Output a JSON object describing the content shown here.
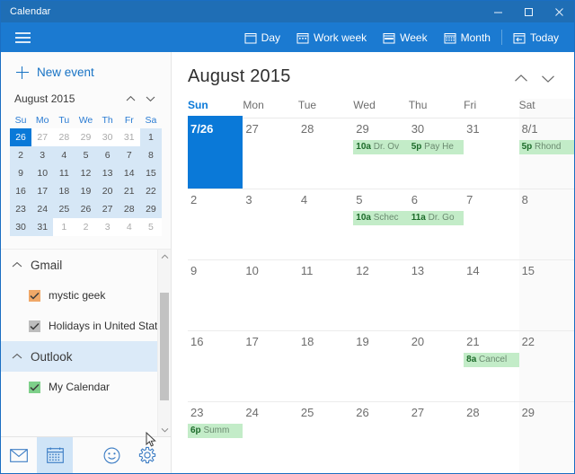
{
  "window": {
    "title": "Calendar",
    "minimize_label": "Minimize",
    "maximize_label": "Maximize",
    "close_label": "Close"
  },
  "commandbar": {
    "menu_label": "Menu",
    "items": [
      {
        "label": "Day",
        "icon": "calendar-day-icon"
      },
      {
        "label": "Work week",
        "icon": "calendar-workweek-icon"
      },
      {
        "label": "Week",
        "icon": "calendar-week-icon"
      },
      {
        "label": "Month",
        "icon": "calendar-month-icon"
      },
      {
        "label": "Today",
        "icon": "calendar-today-icon"
      }
    ]
  },
  "sidebar": {
    "new_event_label": "New event",
    "mini_calendar": {
      "title": "August 2015",
      "prev_label": "Previous month",
      "next_label": "Next month",
      "day_headers": [
        "Su",
        "Mo",
        "Tu",
        "We",
        "Th",
        "Fr",
        "Sa"
      ],
      "weeks": [
        [
          {
            "n": "26",
            "state": "selected"
          },
          {
            "n": "27",
            "state": "out"
          },
          {
            "n": "28",
            "state": "out"
          },
          {
            "n": "29",
            "state": "out"
          },
          {
            "n": "30",
            "state": "out"
          },
          {
            "n": "31",
            "state": "out"
          },
          {
            "n": "1",
            "state": "in"
          }
        ],
        [
          {
            "n": "2",
            "state": "in"
          },
          {
            "n": "3",
            "state": "in"
          },
          {
            "n": "4",
            "state": "in"
          },
          {
            "n": "5",
            "state": "in"
          },
          {
            "n": "6",
            "state": "in"
          },
          {
            "n": "7",
            "state": "in"
          },
          {
            "n": "8",
            "state": "in"
          }
        ],
        [
          {
            "n": "9",
            "state": "in"
          },
          {
            "n": "10",
            "state": "in"
          },
          {
            "n": "11",
            "state": "in"
          },
          {
            "n": "12",
            "state": "in"
          },
          {
            "n": "13",
            "state": "in"
          },
          {
            "n": "14",
            "state": "in"
          },
          {
            "n": "15",
            "state": "in"
          }
        ],
        [
          {
            "n": "16",
            "state": "in"
          },
          {
            "n": "17",
            "state": "in"
          },
          {
            "n": "18",
            "state": "in"
          },
          {
            "n": "19",
            "state": "in"
          },
          {
            "n": "20",
            "state": "in"
          },
          {
            "n": "21",
            "state": "in"
          },
          {
            "n": "22",
            "state": "in"
          }
        ],
        [
          {
            "n": "23",
            "state": "in"
          },
          {
            "n": "24",
            "state": "in"
          },
          {
            "n": "25",
            "state": "in"
          },
          {
            "n": "26",
            "state": "in"
          },
          {
            "n": "27",
            "state": "in"
          },
          {
            "n": "28",
            "state": "in"
          },
          {
            "n": "29",
            "state": "in"
          }
        ],
        [
          {
            "n": "30",
            "state": "in"
          },
          {
            "n": "31",
            "state": "in"
          },
          {
            "n": "1",
            "state": "out"
          },
          {
            "n": "2",
            "state": "out"
          },
          {
            "n": "3",
            "state": "out"
          },
          {
            "n": "4",
            "state": "out"
          },
          {
            "n": "5",
            "state": "out"
          }
        ]
      ]
    },
    "accounts": [
      {
        "name": "Gmail",
        "highlighted": false,
        "calendars": [
          {
            "name": "mystic geek",
            "checked": true,
            "color": "#f0a868"
          },
          {
            "name": "Holidays in United States",
            "checked": true,
            "color": "#bdbdbd"
          }
        ]
      },
      {
        "name": "Outlook",
        "highlighted": true,
        "calendars": [
          {
            "name": "My Calendar",
            "checked": true,
            "color": "#7ed08a"
          }
        ]
      }
    ],
    "bottom_bar": [
      {
        "icon": "mail-icon",
        "label": "Mail",
        "active": false
      },
      {
        "icon": "calendar-icon",
        "label": "Calendar",
        "active": true
      },
      {
        "icon": "feedback-smiley-icon",
        "label": "Feedback",
        "active": false
      },
      {
        "icon": "settings-gear-icon",
        "label": "Settings",
        "active": false
      }
    ]
  },
  "main": {
    "month_title": "August 2015",
    "prev_label": "Previous",
    "next_label": "Next",
    "day_headers": [
      "Sun",
      "Mon",
      "Tue",
      "Wed",
      "Thu",
      "Fri",
      "Sat"
    ],
    "today_column_index": 0,
    "weeks": [
      [
        {
          "label": "7/26",
          "selected": true,
          "events": []
        },
        {
          "label": "27",
          "selected": false,
          "events": []
        },
        {
          "label": "28",
          "selected": false,
          "events": []
        },
        {
          "label": "29",
          "selected": false,
          "events": [
            {
              "time": "10a",
              "title": "Dr. Ov"
            }
          ]
        },
        {
          "label": "30",
          "selected": false,
          "events": [
            {
              "time": "5p",
              "title": "Pay He"
            }
          ]
        },
        {
          "label": "31",
          "selected": false,
          "events": []
        },
        {
          "label": "8/1",
          "selected": false,
          "events": [
            {
              "time": "5p",
              "title": "Rhond"
            }
          ]
        }
      ],
      [
        {
          "label": "2",
          "selected": false,
          "events": []
        },
        {
          "label": "3",
          "selected": false,
          "events": []
        },
        {
          "label": "4",
          "selected": false,
          "events": []
        },
        {
          "label": "5",
          "selected": false,
          "events": [
            {
              "time": "10a",
              "title": "Schec"
            }
          ]
        },
        {
          "label": "6",
          "selected": false,
          "events": [
            {
              "time": "11a",
              "title": "Dr. Go"
            }
          ]
        },
        {
          "label": "7",
          "selected": false,
          "events": []
        },
        {
          "label": "8",
          "selected": false,
          "events": []
        }
      ],
      [
        {
          "label": "9",
          "selected": false,
          "events": []
        },
        {
          "label": "10",
          "selected": false,
          "events": []
        },
        {
          "label": "11",
          "selected": false,
          "events": []
        },
        {
          "label": "12",
          "selected": false,
          "events": []
        },
        {
          "label": "13",
          "selected": false,
          "events": []
        },
        {
          "label": "14",
          "selected": false,
          "events": []
        },
        {
          "label": "15",
          "selected": false,
          "events": []
        }
      ],
      [
        {
          "label": "16",
          "selected": false,
          "events": []
        },
        {
          "label": "17",
          "selected": false,
          "events": []
        },
        {
          "label": "18",
          "selected": false,
          "events": []
        },
        {
          "label": "19",
          "selected": false,
          "events": []
        },
        {
          "label": "20",
          "selected": false,
          "events": []
        },
        {
          "label": "21",
          "selected": false,
          "events": [
            {
              "time": "8a",
              "title": "Cancel"
            }
          ]
        },
        {
          "label": "22",
          "selected": false,
          "events": []
        }
      ],
      [
        {
          "label": "23",
          "selected": false,
          "events": [
            {
              "time": "6p",
              "title": "Summ"
            }
          ]
        },
        {
          "label": "24",
          "selected": false,
          "events": []
        },
        {
          "label": "25",
          "selected": false,
          "events": []
        },
        {
          "label": "26",
          "selected": false,
          "events": []
        },
        {
          "label": "27",
          "selected": false,
          "events": []
        },
        {
          "label": "28",
          "selected": false,
          "events": []
        },
        {
          "label": "29",
          "selected": false,
          "events": []
        }
      ]
    ]
  },
  "colors": {
    "titlebar": "#1f6eb5",
    "commandbar": "#1b7ad1",
    "accent": "#0a79d8",
    "event_bg": "#c3ecc8",
    "event_time": "#1d6b2a",
    "mini_month_bg": "#d6e7f6"
  }
}
